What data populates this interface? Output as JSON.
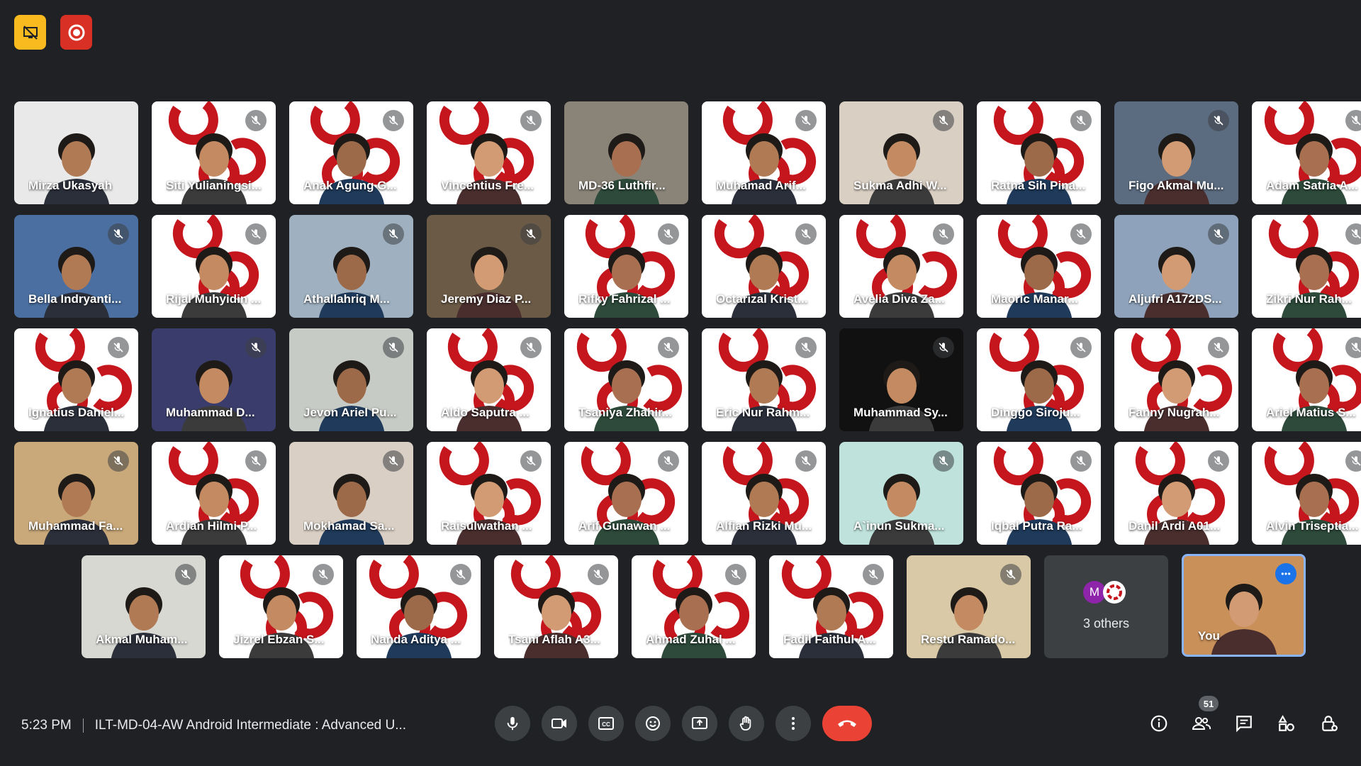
{
  "top": {
    "icons": [
      "presentation-off-icon",
      "record-icon"
    ]
  },
  "participants": [
    {
      "name": "Mirza Ukasyah",
      "bg": "#e9e9e9",
      "muted": false
    },
    {
      "name": "Siti Yulianingsi...",
      "bg": "#ffffff",
      "muted": true
    },
    {
      "name": "Anak Agung G...",
      "bg": "#ffffff",
      "muted": true
    },
    {
      "name": "Vincentius Fre...",
      "bg": "#ffffff",
      "muted": true
    },
    {
      "name": "MD-36 Luthfir...",
      "bg": "#8a8478",
      "muted": false
    },
    {
      "name": "Muhamad Arif...",
      "bg": "#ffffff",
      "muted": true
    },
    {
      "name": "Sukma Adhi W...",
      "bg": "#d9cfc3",
      "muted": true
    },
    {
      "name": "Ratna Sih Pina...",
      "bg": "#ffffff",
      "muted": true
    },
    {
      "name": "Figo Akmal Mu...",
      "bg": "#5b6c80",
      "muted": true
    },
    {
      "name": "Adam Satria A...",
      "bg": "#ffffff",
      "muted": true
    },
    {
      "name": "Bella Indryanti...",
      "bg": "#4a6fa0",
      "muted": true
    },
    {
      "name": "Rijal Muhyidin ...",
      "bg": "#ffffff",
      "muted": true
    },
    {
      "name": "Athallahriq M...",
      "bg": "#9fb1c1",
      "muted": true
    },
    {
      "name": "Jeremy Diaz P...",
      "bg": "#6b5a46",
      "muted": true
    },
    {
      "name": "Rifky Fahrizal ...",
      "bg": "#ffffff",
      "muted": true
    },
    {
      "name": "Octarizal Krist...",
      "bg": "#ffffff",
      "muted": true
    },
    {
      "name": "Avelia Diva Za...",
      "bg": "#ffffff",
      "muted": true
    },
    {
      "name": "Maoric Manar...",
      "bg": "#ffffff",
      "muted": true
    },
    {
      "name": "Aljufri A172DS...",
      "bg": "#8ea3bb",
      "muted": true
    },
    {
      "name": "Zikri Nur Rah...",
      "bg": "#ffffff",
      "muted": true
    },
    {
      "name": "Ignatius Daniel...",
      "bg": "#ffffff",
      "muted": true
    },
    {
      "name": "Muhammad D...",
      "bg": "#3a3d6b",
      "muted": true
    },
    {
      "name": "Jevon Ariel Pu...",
      "bg": "#c7cbc5",
      "muted": true
    },
    {
      "name": "Aldo Saputra ...",
      "bg": "#ffffff",
      "muted": true
    },
    {
      "name": "Tsaniya Zhahir...",
      "bg": "#ffffff",
      "muted": true
    },
    {
      "name": "Eric Nur Rahm...",
      "bg": "#ffffff",
      "muted": true
    },
    {
      "name": "Muhammad Sy...",
      "bg": "#111111",
      "muted": true
    },
    {
      "name": "Dinggo Siroju...",
      "bg": "#ffffff",
      "muted": true
    },
    {
      "name": "Fanny Nugrah...",
      "bg": "#ffffff",
      "muted": true
    },
    {
      "name": "Ariel Matius S...",
      "bg": "#ffffff",
      "muted": true
    },
    {
      "name": "Muhammad Fa...",
      "bg": "#c9a87a",
      "muted": true
    },
    {
      "name": "Ardian Hilmi P...",
      "bg": "#ffffff",
      "muted": true
    },
    {
      "name": "Mokhamad Sa...",
      "bg": "#d9cfc4",
      "muted": true
    },
    {
      "name": "Raisulwathan ...",
      "bg": "#ffffff",
      "muted": true
    },
    {
      "name": "Arif Gunawan ...",
      "bg": "#ffffff",
      "muted": true
    },
    {
      "name": "Alfian Rizki Mu...",
      "bg": "#ffffff",
      "muted": true
    },
    {
      "name": "A`inun Sukma...",
      "bg": "#bfe3dc",
      "muted": true
    },
    {
      "name": "Iqbal Putra Ra...",
      "bg": "#ffffff",
      "muted": true
    },
    {
      "name": "Danil Ardi A01...",
      "bg": "#ffffff",
      "muted": true
    },
    {
      "name": "Alvin Triseptia...",
      "bg": "#ffffff",
      "muted": true
    },
    {
      "name": "Akmal Muham...",
      "bg": "#d8d8d3",
      "muted": true
    },
    {
      "name": "Jizrel Ebzan S...",
      "bg": "#ffffff",
      "muted": true
    },
    {
      "name": "Nanda Aditya ...",
      "bg": "#ffffff",
      "muted": true
    },
    {
      "name": "Tsani Aflah A3...",
      "bg": "#ffffff",
      "muted": true
    },
    {
      "name": "Ahmad Zuhal ...",
      "bg": "#ffffff",
      "muted": true
    },
    {
      "name": "Fadil Faithul A...",
      "bg": "#ffffff",
      "muted": true
    },
    {
      "name": "Restu Ramado...",
      "bg": "#d9c9a6",
      "muted": true
    }
  ],
  "others": {
    "label": "3 others",
    "avatar_letter": "M",
    "avatar_color": "#8e24aa"
  },
  "self": {
    "name": "You",
    "bg": "#c9905a"
  },
  "bottom": {
    "time": "5:23 PM",
    "meeting_title": "ILT-MD-04-AW Android Intermediate : Advanced U...",
    "controls": [
      "mic-icon",
      "camera-icon",
      "captions-icon",
      "emoji-icon",
      "present-icon",
      "raise-hand-icon",
      "more-options-icon",
      "hang-up-icon"
    ],
    "right_icons": [
      "info-icon",
      "people-icon",
      "chat-icon",
      "activities-icon",
      "host-controls-icon"
    ],
    "participant_count": "51"
  },
  "colors": {
    "background": "#202124",
    "tile": "#3c4043",
    "hangup": "#ea4335",
    "brand_red": "#c4161c",
    "self_border": "#8ab4f8"
  }
}
